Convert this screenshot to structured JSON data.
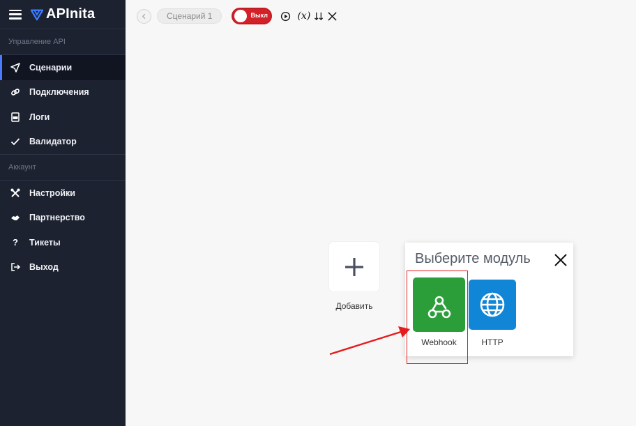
{
  "brand": {
    "name": "APInita"
  },
  "sidebar": {
    "sections": [
      {
        "label": "Управление API",
        "items": [
          {
            "label": "Сценарии",
            "icon": "send-icon",
            "active": true
          },
          {
            "label": "Подключения",
            "icon": "link-icon",
            "active": false
          },
          {
            "label": "Логи",
            "icon": "log-icon",
            "active": false
          },
          {
            "label": "Валидатор",
            "icon": "check-icon",
            "active": false
          }
        ]
      },
      {
        "label": "Аккаунт",
        "items": [
          {
            "label": "Настройки",
            "icon": "tools-icon",
            "active": false
          },
          {
            "label": "Партнерство",
            "icon": "handshake-icon",
            "active": false
          },
          {
            "label": "Тикеты",
            "icon": "question-icon",
            "active": false
          },
          {
            "label": "Выход",
            "icon": "logout-icon",
            "active": false
          }
        ]
      }
    ]
  },
  "topbar": {
    "scenario_name": "Сценарий 1",
    "toggle_label": "Выкл",
    "toggle_on": false,
    "variables_symbol": "(x)"
  },
  "canvas": {
    "add_label": "Добавить"
  },
  "popup": {
    "title": "Выберите модуль",
    "modules": [
      {
        "label": "Webhook",
        "color": "#2b9e3a",
        "icon": "webhook-icon"
      },
      {
        "label": "HTTP",
        "color": "#1185d6",
        "icon": "globe-icon"
      }
    ]
  },
  "colors": {
    "sidebar_bg": "#1d2231",
    "accent": "#4a7bff",
    "toggle_off": "#d3212a",
    "highlight": "#e41c1c"
  }
}
